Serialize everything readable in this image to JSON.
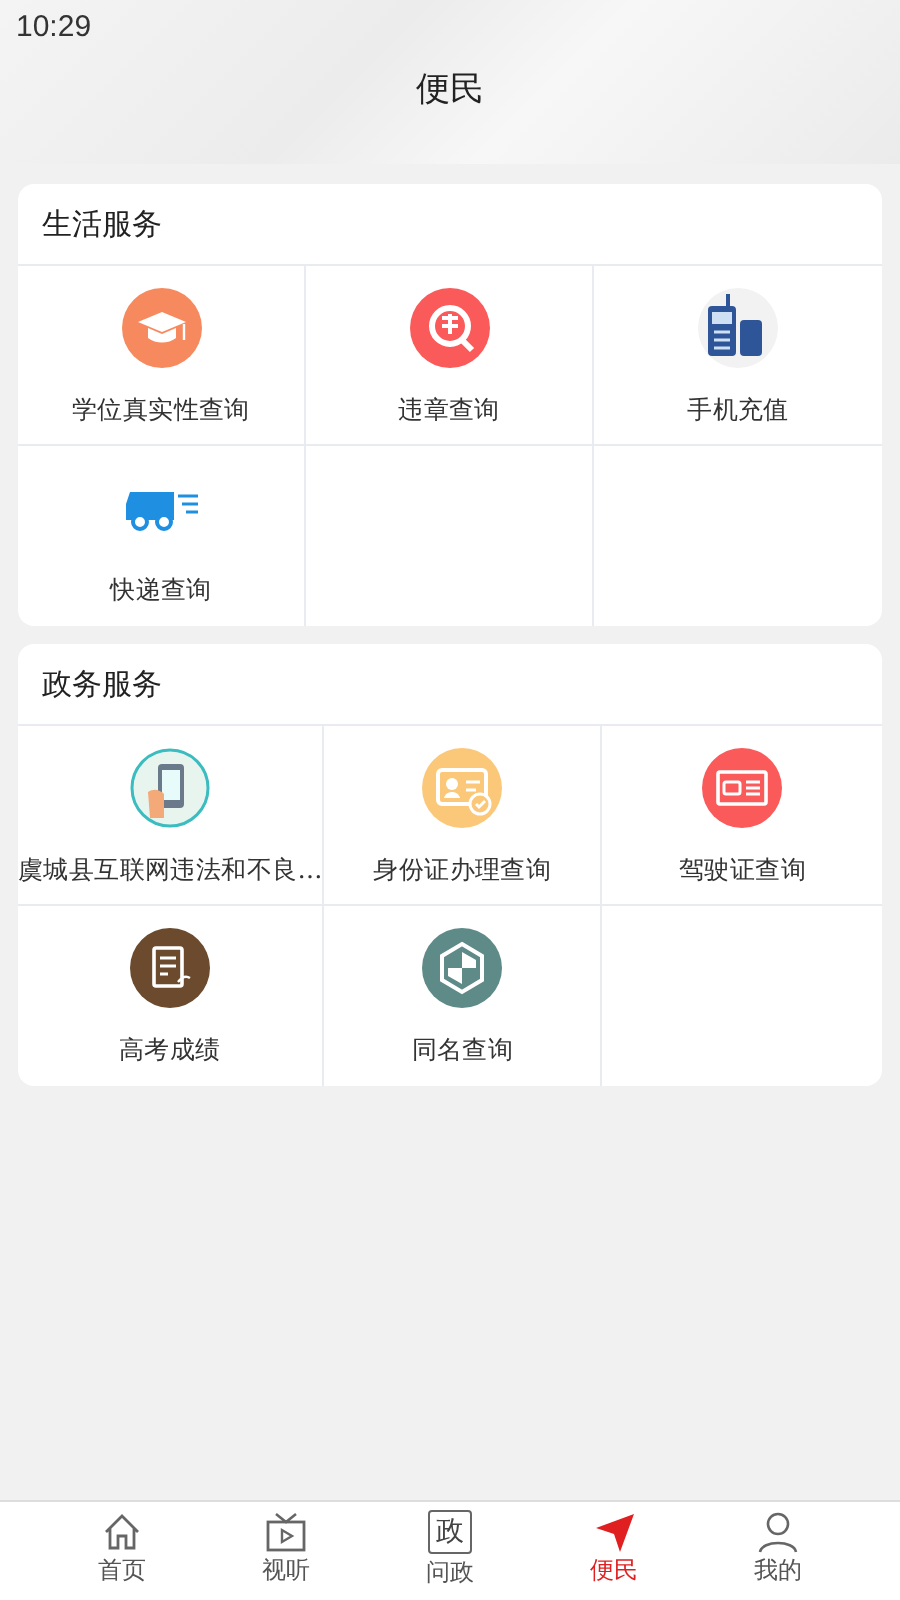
{
  "status_bar": {
    "time": "10:29"
  },
  "header": {
    "title": "便民"
  },
  "sections": [
    {
      "title": "生活服务",
      "items": [
        {
          "label": "学位真实性查询",
          "kind": "degree"
        },
        {
          "label": "违章查询",
          "kind": "violation"
        },
        {
          "label": "手机充值",
          "kind": "phone"
        },
        {
          "label": "快递查询",
          "kind": "truck"
        }
      ]
    },
    {
      "title": "政务服务",
      "items": [
        {
          "label": "虞城县互联网违法和不良…",
          "kind": "report"
        },
        {
          "label": "身份证办理查询",
          "kind": "idcard"
        },
        {
          "label": "驾驶证查询",
          "kind": "license"
        },
        {
          "label": "高考成绩",
          "kind": "exam"
        },
        {
          "label": "同名查询",
          "kind": "shield"
        }
      ]
    }
  ],
  "nav": [
    {
      "label": "首页",
      "kind": "home",
      "selected": false
    },
    {
      "label": "视听",
      "kind": "tv",
      "selected": false
    },
    {
      "label": "问政",
      "kind": "boxed",
      "icon_text": "政",
      "selected": false
    },
    {
      "label": "便民",
      "kind": "plane",
      "selected": true
    },
    {
      "label": "我的",
      "kind": "person",
      "selected": false
    }
  ]
}
